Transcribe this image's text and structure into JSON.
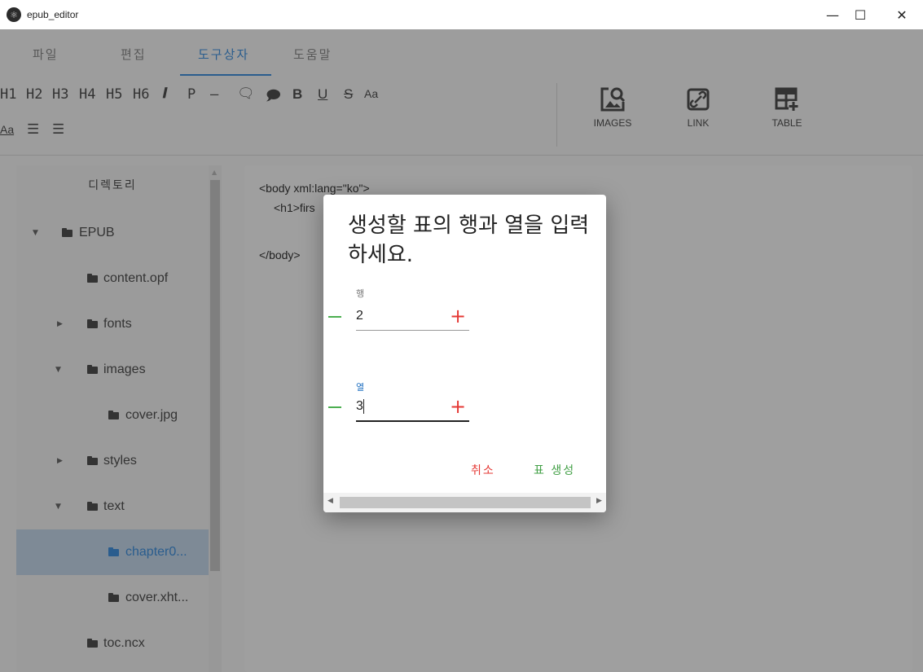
{
  "window": {
    "title": "epub_editor",
    "minimize": "—",
    "maximize": "☐",
    "close": "✕"
  },
  "menu": {
    "items": [
      "파일",
      "편집",
      "도구상자",
      "도움말"
    ],
    "active_index": 2
  },
  "toolbar": {
    "headings": [
      "H1",
      "H2",
      "H3",
      "H4",
      "H5",
      "H6"
    ],
    "italic": "𝑰",
    "paragraph": "P",
    "hr": "—",
    "comment_a": "🗨",
    "comment_b": "🗩",
    "bold": "B",
    "underline": "U",
    "strike": "S",
    "font_size_up": "Aa",
    "font_size_down": "Aa",
    "bullet_list": "☰",
    "numbered_list": "☰",
    "images_label": "IMAGES",
    "link_label": "LINK",
    "table_label": "TABLE"
  },
  "sidebar": {
    "title": "디렉토리",
    "items": [
      {
        "label": "EPUB",
        "expanded": "open",
        "icon": "folder-icon"
      },
      {
        "label": "content.opf",
        "icon": "folder-icon"
      },
      {
        "label": "fonts",
        "expanded": "closed",
        "icon": "folder-icon"
      },
      {
        "label": "images",
        "expanded": "open",
        "icon": "folder-icon"
      },
      {
        "label": "cover.jpg",
        "icon": "folder-icon"
      },
      {
        "label": "styles",
        "expanded": "closed",
        "icon": "folder-icon"
      },
      {
        "label": "text",
        "expanded": "open",
        "icon": "folder-icon"
      },
      {
        "label": "chapter0...",
        "icon": "folder-icon",
        "selected": true
      },
      {
        "label": "cover.xht...",
        "icon": "folder-icon"
      },
      {
        "label": "toc.ncx",
        "icon": "folder-icon"
      }
    ]
  },
  "editor": {
    "lines": [
      "<body xml:lang=\"ko\">",
      "<h1>firs",
      "</body>"
    ]
  },
  "dialog": {
    "title": "생성할 표의 행과 열을 입력하세요.",
    "rows_label": "행",
    "rows_value": "2",
    "cols_label": "열",
    "cols_value": "3",
    "cancel": "취소",
    "create": "표 생성"
  },
  "colors": {
    "accent": "#2a5d8e",
    "cancel": "#e53935",
    "create": "#43a047",
    "focus_label": "#1e6fc0"
  }
}
